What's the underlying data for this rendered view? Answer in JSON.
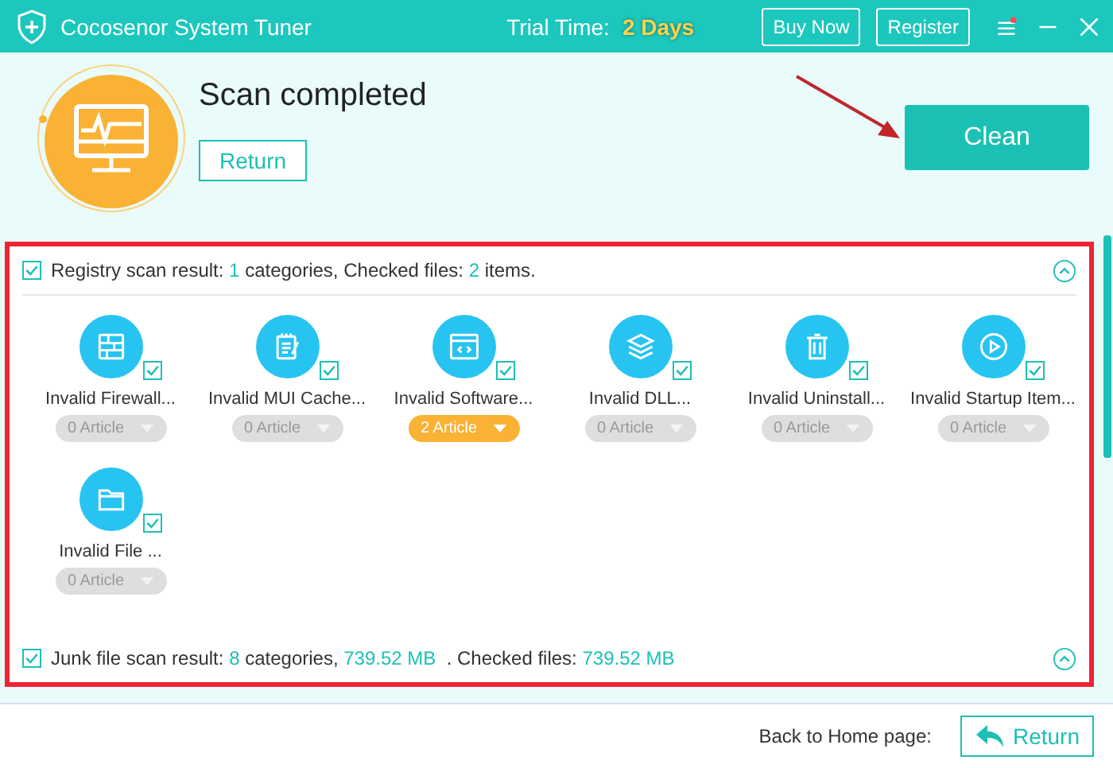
{
  "window": {
    "title": "Cocosenor System Tuner",
    "trial_label": "Trial Time:",
    "trial_value": "2 Days",
    "buttons": [
      "Buy Now",
      "Register"
    ],
    "menu_notification": true
  },
  "header": {
    "status": "Scan completed",
    "return_button": "Return",
    "clean_button": "Clean"
  },
  "sections": [
    {
      "checked": true,
      "expanded": true,
      "summary": [
        {
          "text": "Registry scan result: ",
          "highlight": false
        },
        {
          "text": "1",
          "highlight": true
        },
        {
          "text": " categories, Checked files: ",
          "highlight": false
        },
        {
          "text": "2",
          "highlight": true
        },
        {
          "text": " items.",
          "highlight": false
        }
      ],
      "items": [
        {
          "kind": "firewall",
          "label": "Invalid Firewall...",
          "checked": true,
          "count": "0 Article",
          "has_items": false
        },
        {
          "kind": "notes",
          "label": "Invalid MUI Cache...",
          "checked": true,
          "count": "0 Article",
          "has_items": false
        },
        {
          "kind": "code",
          "label": "Invalid Software...",
          "checked": true,
          "count": "2 Article",
          "has_items": true
        },
        {
          "kind": "layers",
          "label": "Invalid DLL...",
          "checked": true,
          "count": "0 Article",
          "has_items": false
        },
        {
          "kind": "trash",
          "label": "Invalid Uninstall...",
          "checked": true,
          "count": "0 Article",
          "has_items": false
        },
        {
          "kind": "play",
          "label": "Invalid Startup Item...",
          "checked": true,
          "count": "0 Article",
          "has_items": false
        },
        {
          "kind": "folder",
          "label": "Invalid File ...",
          "checked": true,
          "count": "0 Article",
          "has_items": false
        }
      ]
    },
    {
      "checked": true,
      "expanded": true,
      "summary": [
        {
          "text": "Junk file scan result: ",
          "highlight": false
        },
        {
          "text": "8",
          "highlight": true
        },
        {
          "text": " categories, ",
          "highlight": false
        },
        {
          "text": "739.52 MB",
          "highlight": true
        },
        {
          "text": "  . Checked files: ",
          "highlight": false
        },
        {
          "text": "739.52 MB",
          "highlight": true
        }
      ]
    }
  ],
  "footer": {
    "label": "Back to Home page:",
    "return_button": "Return"
  }
}
